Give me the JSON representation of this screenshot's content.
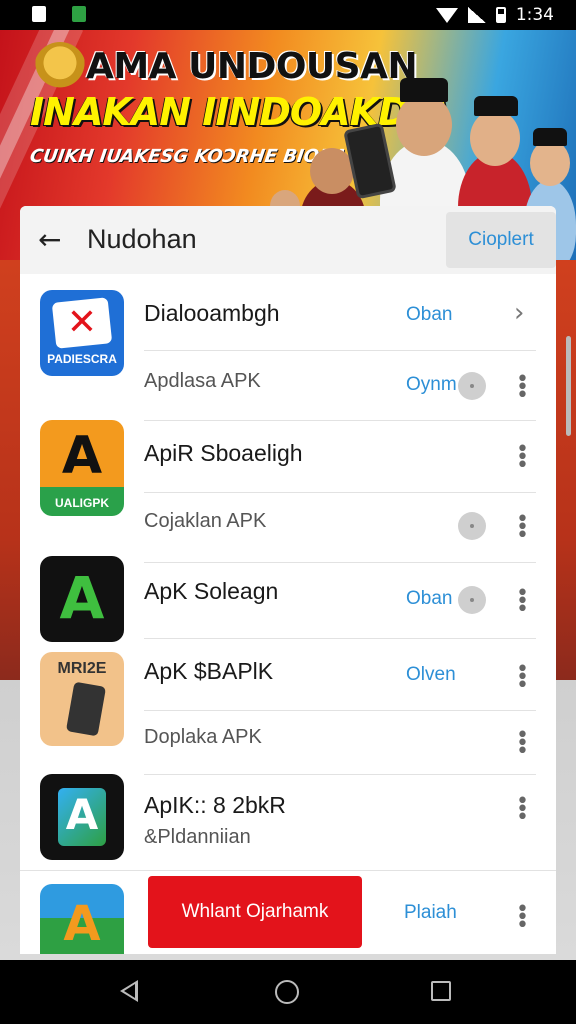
{
  "status_bar": {
    "time": "1:34",
    "icons": [
      "notification-icon",
      "whatsapp-icon",
      "wifi-icon",
      "signal-icon",
      "battery-icon"
    ]
  },
  "banner": {
    "title_line1": "AMA UNDOUSAN",
    "title_line2": "INAKAN IINDOAKDIA",
    "subtitle": "CUIKH IUAKESG KOƆRHE BIOKAN"
  },
  "sheet": {
    "title": "Nudohan",
    "header_action": "Cioplert",
    "apps": [
      {
        "icon_caption": "PADIESCRA",
        "icon_colors": [
          "#1f6fd6",
          "#ffffff"
        ],
        "title": "Dialooambgh",
        "title_link": "Oban",
        "subtitle": "Apdlasa APK",
        "subtitle_link": "Oynm"
      },
      {
        "icon_caption": "UALIGPK",
        "icon_colors": [
          "#f39a1e",
          "#2aa14a"
        ],
        "title": "ApiR Sboaeligh",
        "subtitle": "Cojaklan APK"
      },
      {
        "icon_caption": "",
        "icon_colors": [
          "#111111",
          "#3fbf3f"
        ],
        "title": "ApK Soleagn",
        "title_link": "Oban"
      },
      {
        "icon_caption": "MRI2E",
        "icon_colors": [
          "#f2c28a",
          "#333333"
        ],
        "title": "ApK $BAPlK",
        "title_link": "Olven",
        "subtitle": "Doplaka APK"
      },
      {
        "icon_caption": "",
        "icon_colors": [
          "#111111",
          "#33b0f2"
        ],
        "title": "ApIK:: 8 2bkR",
        "subtitle": "&Pldanniian"
      },
      {
        "icon_caption": "",
        "icon_colors": [
          "#2f9be0",
          "#f39a1e"
        ]
      }
    ],
    "cta_button": "Whlant Ojarhamk",
    "bottom_link": "Plaiah"
  },
  "nav_bar": {
    "icons": [
      "back-icon",
      "home-icon",
      "recents-icon"
    ]
  }
}
